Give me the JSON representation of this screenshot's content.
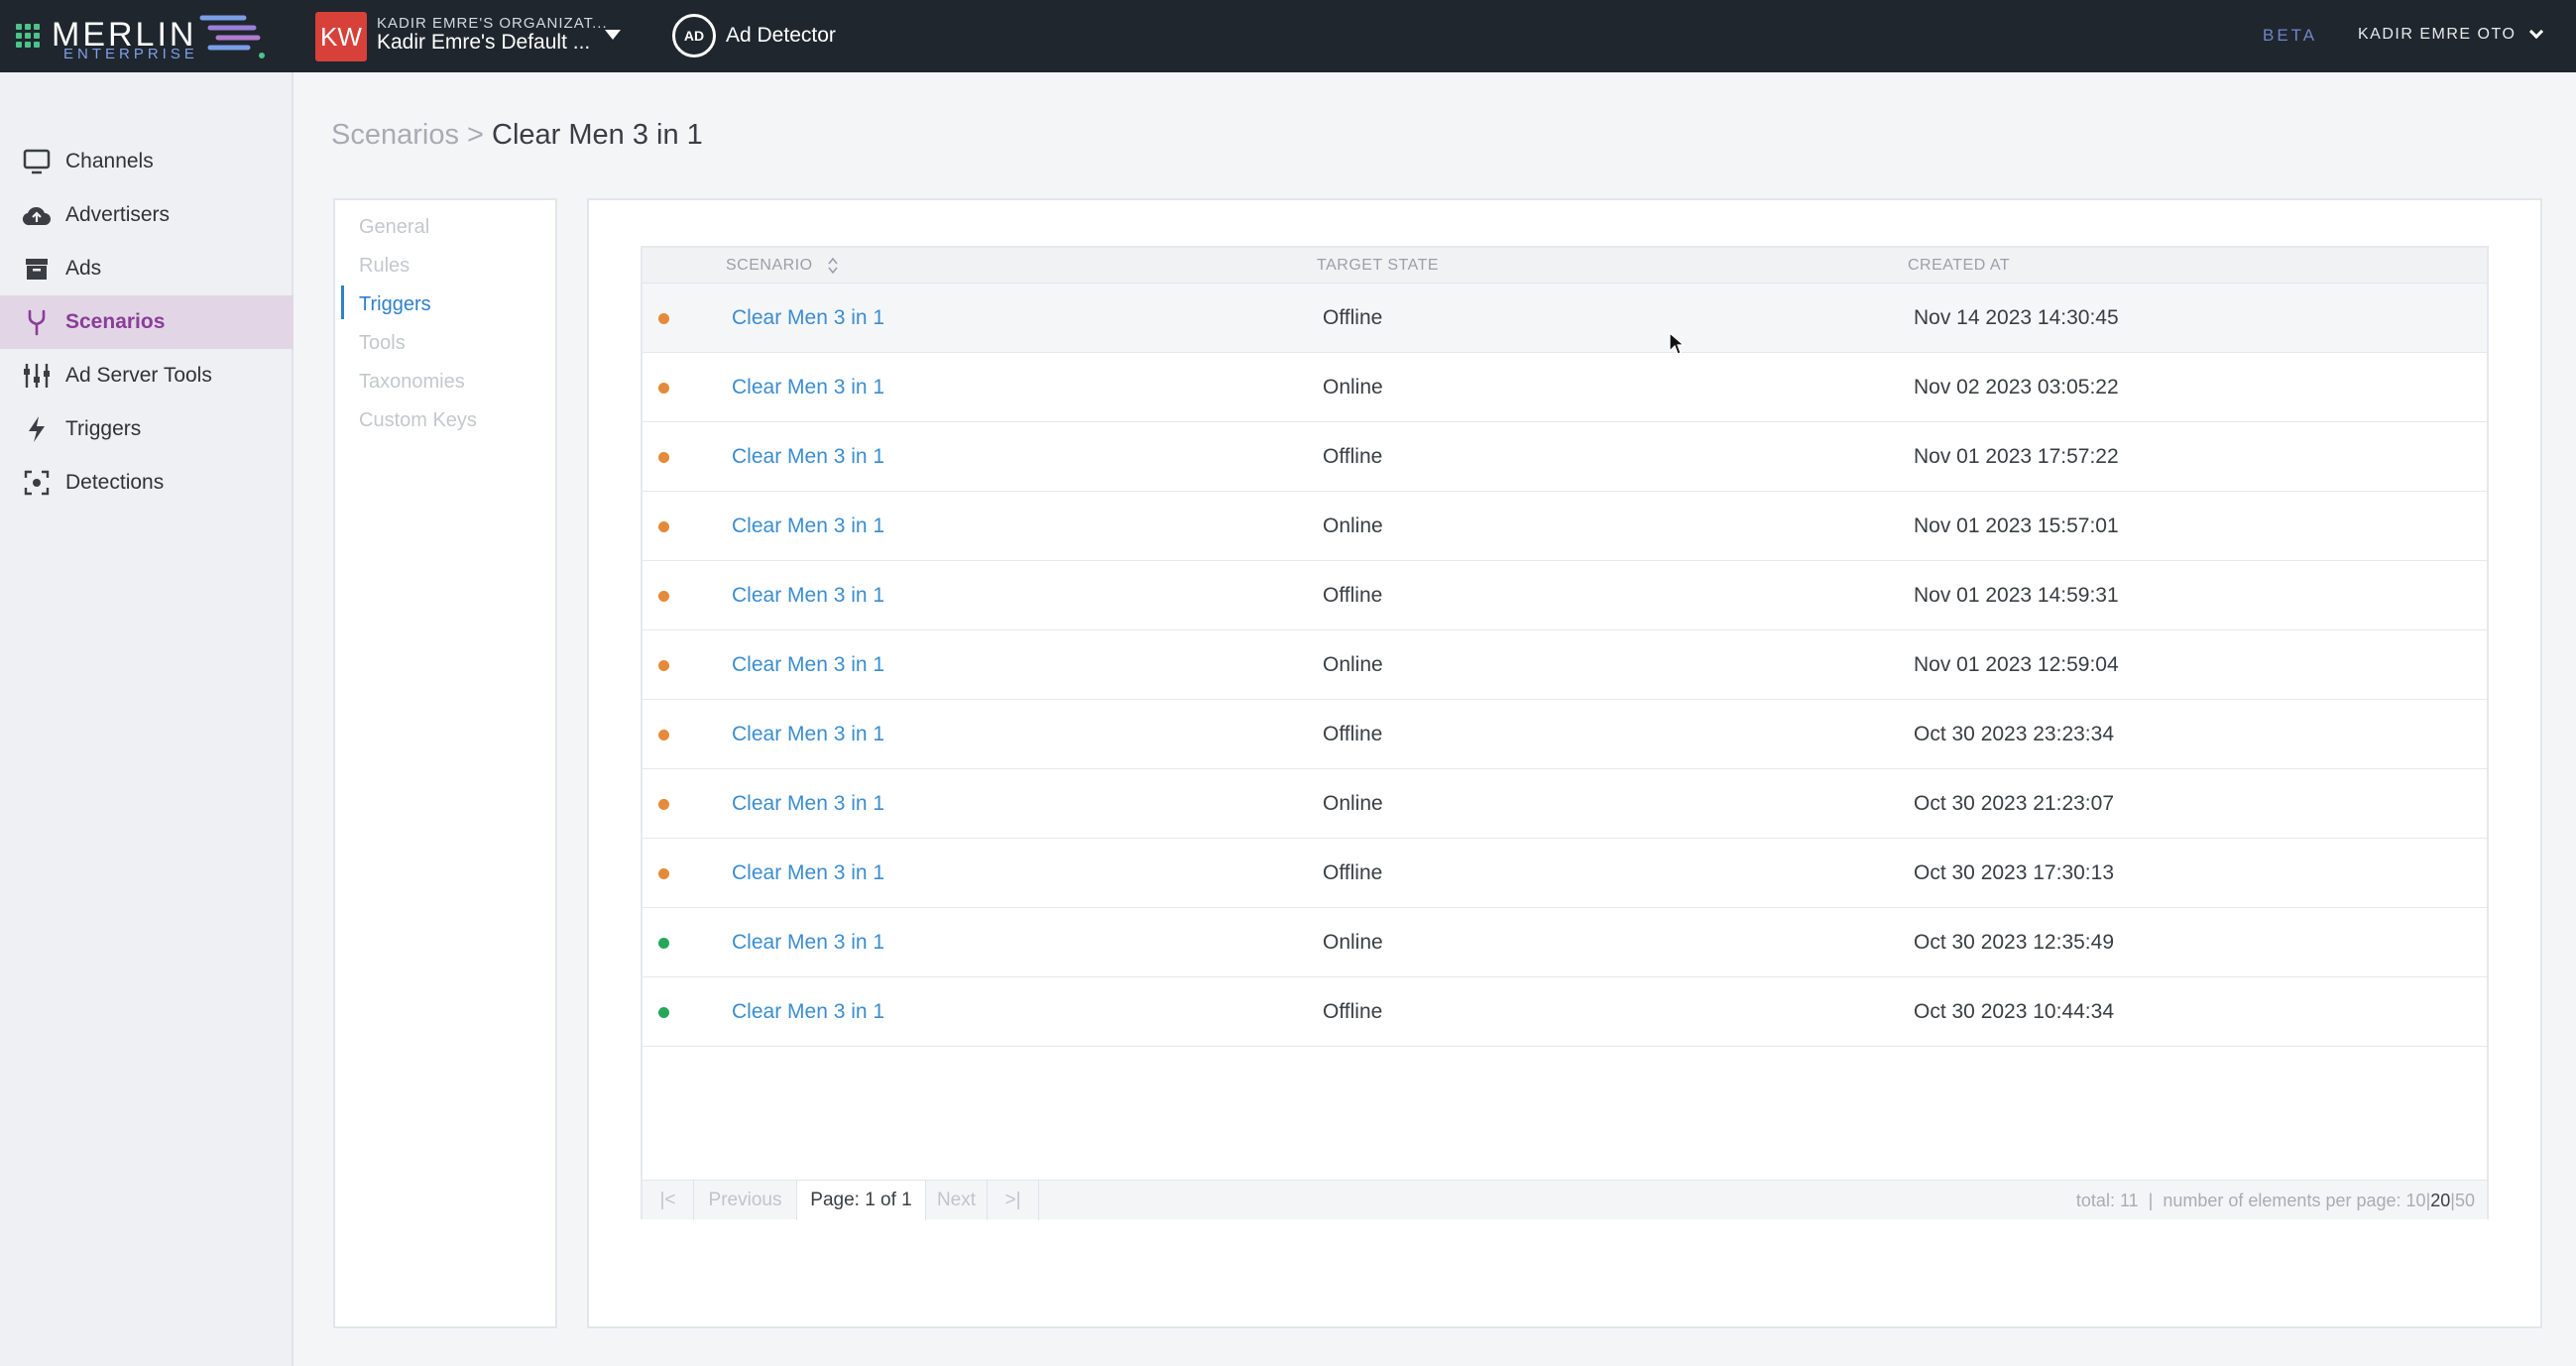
{
  "header": {
    "brand": "MERLIN",
    "brand_sub": "ENTERPRISE",
    "org_avatar": "KW",
    "org_line1": "KADIR EMRE'S ORGANIZAT...",
    "org_line2": "Kadir Emre's Default ...",
    "app_icon_text": "AD",
    "app_name": "Ad Detector",
    "beta": "BETA",
    "user": "KADIR EMRE OTO",
    "accent_color": "#8a3d98"
  },
  "sidebar": {
    "items": [
      {
        "label": "Channels",
        "icon": "monitor-icon"
      },
      {
        "label": "Advertisers",
        "icon": "cloud-upload-icon"
      },
      {
        "label": "Ads",
        "icon": "archive-icon"
      },
      {
        "label": "Scenarios",
        "icon": "fork-icon",
        "active": true
      },
      {
        "label": "Ad Server Tools",
        "icon": "sliders-icon"
      },
      {
        "label": "Triggers",
        "icon": "bolt-icon"
      },
      {
        "label": "Detections",
        "icon": "scan-icon"
      }
    ]
  },
  "breadcrumb": {
    "parent": "Scenarios",
    "separator": ">",
    "current": "Clear Men 3 in 1"
  },
  "subnav": {
    "items": [
      {
        "label": "General"
      },
      {
        "label": "Rules"
      },
      {
        "label": "Triggers",
        "active": true
      },
      {
        "label": "Tools"
      },
      {
        "label": "Taxonomies"
      },
      {
        "label": "Custom Keys"
      }
    ]
  },
  "table": {
    "columns": {
      "scenario": "SCENARIO",
      "target_state": "TARGET STATE",
      "created_at": "CREATED AT"
    },
    "rows": [
      {
        "status": "orange",
        "scenario": "Clear Men 3 in 1",
        "target_state": "Offline",
        "created_at": "Nov 14 2023 14:30:45"
      },
      {
        "status": "orange",
        "scenario": "Clear Men 3 in 1",
        "target_state": "Online",
        "created_at": "Nov 02 2023 03:05:22"
      },
      {
        "status": "orange",
        "scenario": "Clear Men 3 in 1",
        "target_state": "Offline",
        "created_at": "Nov 01 2023 17:57:22"
      },
      {
        "status": "orange",
        "scenario": "Clear Men 3 in 1",
        "target_state": "Online",
        "created_at": "Nov 01 2023 15:57:01"
      },
      {
        "status": "orange",
        "scenario": "Clear Men 3 in 1",
        "target_state": "Offline",
        "created_at": "Nov 01 2023 14:59:31"
      },
      {
        "status": "orange",
        "scenario": "Clear Men 3 in 1",
        "target_state": "Online",
        "created_at": "Nov 01 2023 12:59:04"
      },
      {
        "status": "orange",
        "scenario": "Clear Men 3 in 1",
        "target_state": "Offline",
        "created_at": "Oct 30 2023 23:23:34"
      },
      {
        "status": "orange",
        "scenario": "Clear Men 3 in 1",
        "target_state": "Online",
        "created_at": "Oct 30 2023 21:23:07"
      },
      {
        "status": "orange",
        "scenario": "Clear Men 3 in 1",
        "target_state": "Offline",
        "created_at": "Oct 30 2023 17:30:13"
      },
      {
        "status": "green",
        "scenario": "Clear Men 3 in 1",
        "target_state": "Online",
        "created_at": "Oct 30 2023 12:35:49"
      },
      {
        "status": "green",
        "scenario": "Clear Men 3 in 1",
        "target_state": "Offline",
        "created_at": "Oct 30 2023 10:44:34"
      }
    ],
    "status_colors": {
      "orange": "#e58a3a",
      "green": "#27a65a"
    }
  },
  "pagination": {
    "first": "|<",
    "previous": "Previous",
    "page_label": "Page: 1 of 1",
    "next": "Next",
    "last": ">|",
    "total_label": "total: 11",
    "divider": "|",
    "per_page_label": "number of elements per page:",
    "per_page_options": [
      "10",
      "20",
      "50"
    ],
    "per_page_selected": "20"
  }
}
